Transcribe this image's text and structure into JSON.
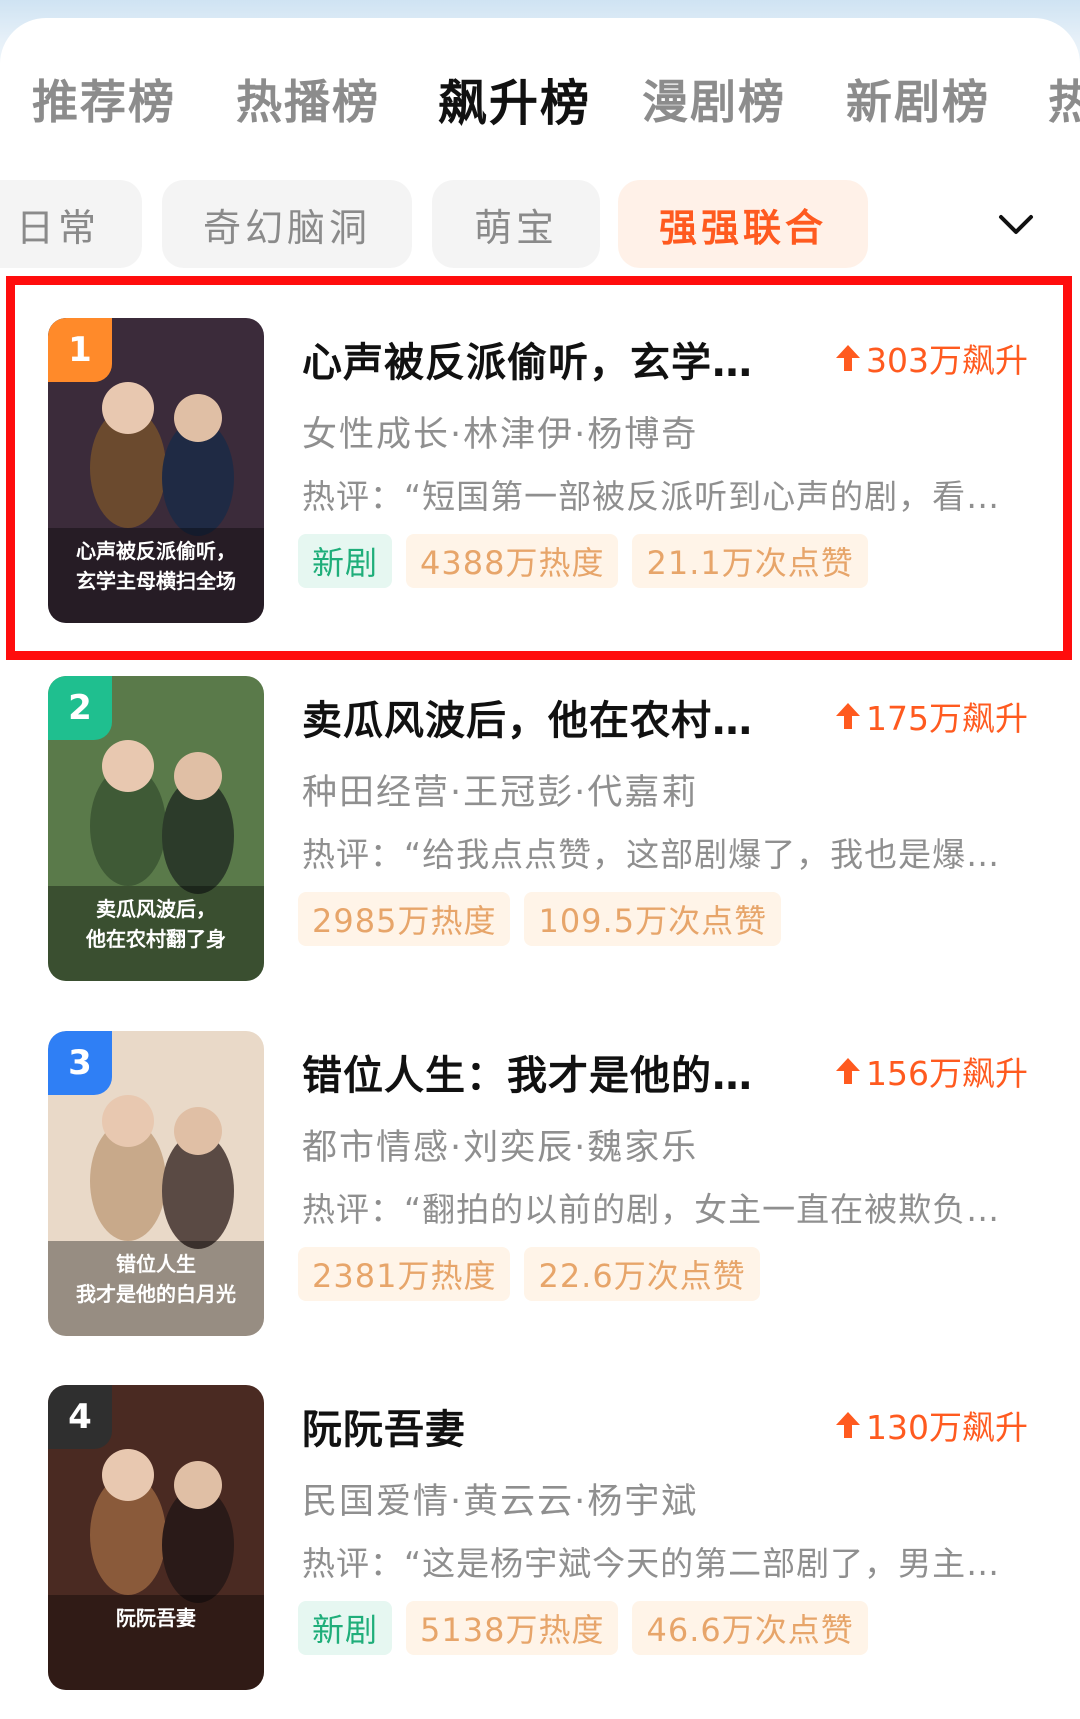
{
  "tabs": [
    {
      "label": "推荐榜",
      "active": false
    },
    {
      "label": "热播榜",
      "active": false
    },
    {
      "label": "飙升榜",
      "active": true
    },
    {
      "label": "漫剧榜",
      "active": false
    },
    {
      "label": "新剧榜",
      "active": false
    },
    {
      "label": "热",
      "active": false
    }
  ],
  "chips": [
    {
      "label": "日常",
      "active": false
    },
    {
      "label": "奇幻脑洞",
      "active": false
    },
    {
      "label": "萌宝",
      "active": false
    },
    {
      "label": "强强联合",
      "active": true
    }
  ],
  "expand_icon": "chevron-down-icon",
  "items": [
    {
      "rank": "1",
      "rank_color": "#ff8a2a",
      "title": "心声被反派偷听，玄学…",
      "rise": "303万飙升",
      "meta": "女性成长·林津伊·杨博奇",
      "comment": "热评：“短国第一部被反派听到心声的剧，看…",
      "tags": [
        "新剧",
        "4388万热度",
        "21.1万次点赞"
      ],
      "poster_text": [
        "心声被反派偷听，",
        "玄学主母横扫全场"
      ],
      "poster_colors": [
        "#3b2b3a",
        "#6b4a2e",
        "#1f2a44"
      ]
    },
    {
      "rank": "2",
      "rank_color": "#1fbf8f",
      "title": "卖瓜风波后，他在农村…",
      "rise": "175万飙升",
      "meta": "种田经营·王冠彭·代嘉莉",
      "comment": "热评：“给我点点赞，这部剧爆了，我也是爆…",
      "tags": [
        "2985万热度",
        "109.5万次点赞"
      ],
      "poster_text": [
        "卖瓜风波后，",
        "他在农村翻了身"
      ],
      "poster_colors": [
        "#5a7a4a",
        "#3f5a36",
        "#2c3b2a"
      ]
    },
    {
      "rank": "3",
      "rank_color": "#2f7ff5",
      "title": "错位人生：我才是他的…",
      "rise": "156万飙升",
      "meta": "都市情感·刘奕辰·魏家乐",
      "comment": "热评：“翻拍的以前的剧，女主一直在被欺负…",
      "tags": [
        "2381万热度",
        "22.6万次点赞"
      ],
      "poster_text": [
        "错位人生",
        "我才是他的白月光"
      ],
      "poster_colors": [
        "#e9d9c8",
        "#c8a98a",
        "#5a4a44"
      ]
    },
    {
      "rank": "4",
      "rank_color": "#2f2f2f",
      "title": "阮阮吾妻",
      "rise": "130万飙升",
      "meta": "民国爱情·黄云云·杨宇斌",
      "comment": "热评：“这是杨宇斌今天的第二部剧了，男主…",
      "tags": [
        "新剧",
        "5138万热度",
        "46.6万次点赞"
      ],
      "poster_text": [
        "阮阮吾妻"
      ],
      "poster_colors": [
        "#4a2a22",
        "#8a5a3a",
        "#2a1a18"
      ]
    }
  ],
  "colors": {
    "accent": "#ff5a1f",
    "highlight": "#ff0d0d",
    "new_tag_text": "#1fae7a",
    "stat_tag_text": "#e7a56a"
  }
}
